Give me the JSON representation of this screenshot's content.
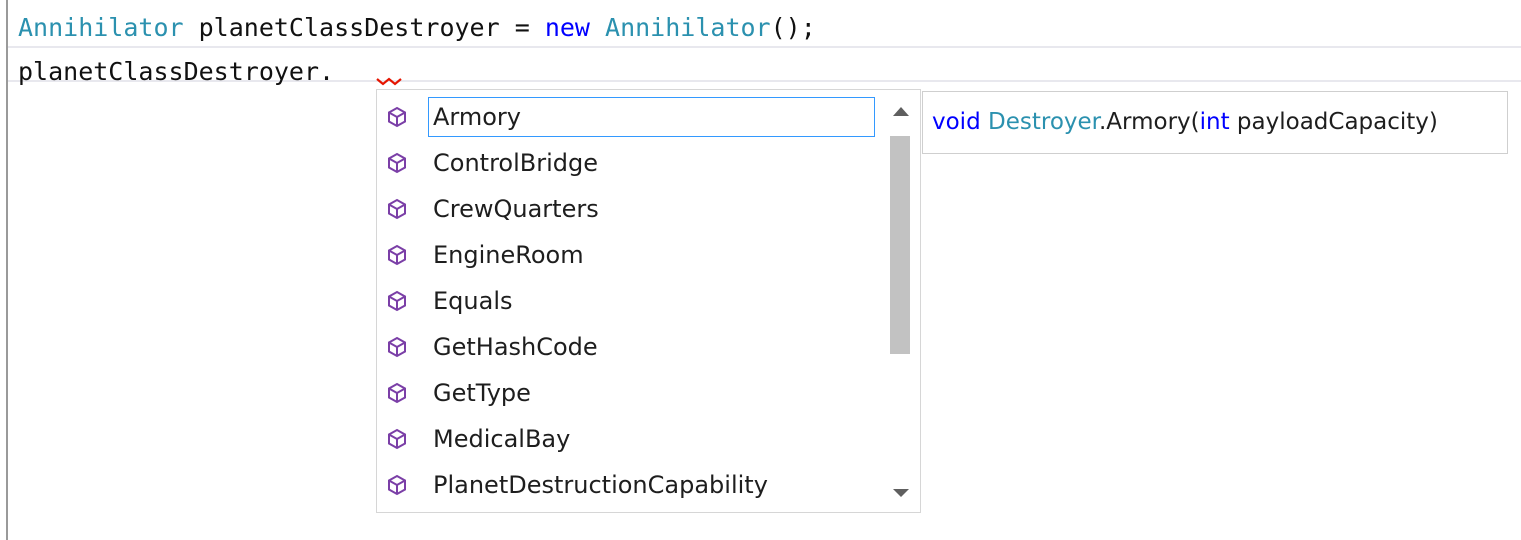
{
  "colors": {
    "keyword": "#0000ff",
    "type_name": "#2b91af",
    "plain_text": "#111111",
    "method_icon": "#7b3fa7",
    "selection_border": "#3399ff",
    "error_squiggle": "#e51400"
  },
  "code": {
    "line1": {
      "type": "Annihilator",
      "identifier": " planetClassDestroyer = ",
      "keyword": "new",
      "space": " ",
      "type2": "Annihilator",
      "tail": "();"
    },
    "line2": {
      "text": "planetClassDestroyer."
    }
  },
  "completion": {
    "icon": "method-cube-icon",
    "selected_index": 0,
    "items": [
      {
        "label": "Armory"
      },
      {
        "label": "ControlBridge"
      },
      {
        "label": "CrewQuarters"
      },
      {
        "label": "EngineRoom"
      },
      {
        "label": "Equals"
      },
      {
        "label": "GetHashCode"
      },
      {
        "label": "GetType"
      },
      {
        "label": "MedicalBay"
      },
      {
        "label": "PlanetDestructionCapability"
      }
    ]
  },
  "tooltip": {
    "return_type": "void",
    "class_name": "Destroyer",
    "method": ".Armory(",
    "param_type": "int",
    "param_name": " payloadCapacity)"
  }
}
